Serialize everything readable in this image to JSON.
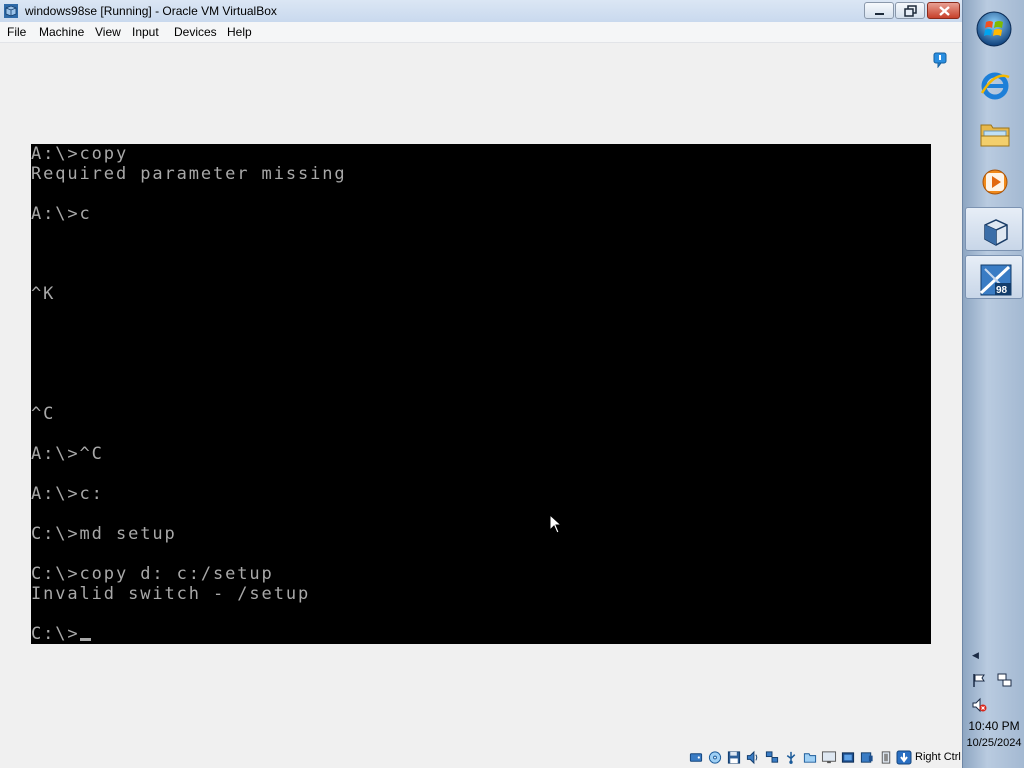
{
  "window": {
    "title": "windows98se [Running] - Oracle VM VirtualBox",
    "icon": "virtualbox-icon"
  },
  "menu": {
    "items": [
      "File",
      "Machine",
      "View",
      "Input",
      "Devices",
      "Help"
    ]
  },
  "console": {
    "lines": [
      "A:\\>copy",
      "Required parameter missing",
      "",
      "A:\\>c",
      "",
      "",
      "",
      "^K",
      "",
      "",
      "",
      "",
      "",
      "^C",
      "",
      "A:\\>^C",
      "",
      "A:\\>c:",
      "",
      "C:\\>md setup",
      "",
      "C:\\>copy d: c:/setup",
      "Invalid switch - /setup",
      "",
      "C:\\>"
    ],
    "text_color": "#a8a8a8",
    "background": "#000000"
  },
  "statusbar": {
    "host_key": "Right Ctrl",
    "icons": [
      "hard-disk-icon",
      "optical-drive-icon",
      "floppy-icon",
      "audio-icon",
      "network-icon",
      "usb-icon",
      "shared-folders-icon",
      "display-icon",
      "video-capture-icon",
      "recording-icon",
      "cpu-icon",
      "mouse-integration-icon",
      "keyboard-icon"
    ]
  },
  "taskbar": {
    "apps": [
      "start-orb",
      "internet-explorer-icon",
      "windows-explorer-icon",
      "media-player-icon",
      "virtualbox-icon",
      "windows98-vm-icon"
    ],
    "clock_time": "10:40 PM",
    "clock_date": "10/25/2024"
  },
  "colors": {
    "titlebar": "#c9d9ee",
    "close_button": "#c7402b",
    "taskbar": "#a4b9d2"
  }
}
